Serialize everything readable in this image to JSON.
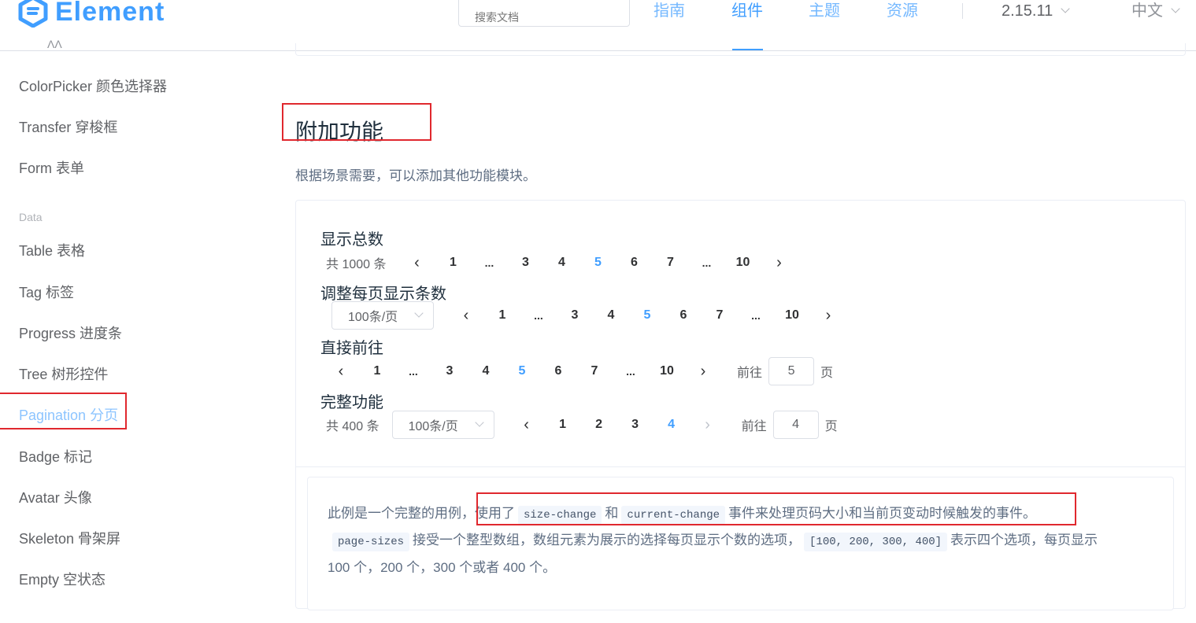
{
  "header": {
    "logo_text": "Element",
    "search_placeholder": "搜索文档",
    "nav": [
      "指南",
      "组件",
      "主题",
      "资源"
    ],
    "active_nav": "组件",
    "version": "2.15.11",
    "language": "中文"
  },
  "sidebar": {
    "cut_item": "ΛΛ",
    "items": [
      "ColorPicker 颜色选择器",
      "Transfer 穿梭框",
      "Form 表单"
    ],
    "group": "Data",
    "data_items": [
      "Table 表格",
      "Tag 标签",
      "Progress 进度条",
      "Tree 树形控件",
      "Pagination 分页",
      "Badge 标记",
      "Avatar 头像",
      "Skeleton 骨架屏",
      "Empty 空状态"
    ],
    "active_item": "Pagination 分页"
  },
  "main": {
    "section_title": "附加功能",
    "description": "根据场景需要，可以添加其他功能模块。",
    "demos": {
      "total": {
        "title": "显示总数",
        "total_label": "共 1000 条",
        "pages": [
          "1",
          "...",
          "3",
          "4",
          "5",
          "6",
          "7",
          "...",
          "10"
        ],
        "current": "5"
      },
      "sizes": {
        "title": "调整每页显示条数",
        "size_value": "100条/页",
        "pages": [
          "1",
          "...",
          "3",
          "4",
          "5",
          "6",
          "7",
          "...",
          "10"
        ],
        "current": "5"
      },
      "jumper": {
        "title": "直接前往",
        "pages": [
          "1",
          "...",
          "3",
          "4",
          "5",
          "6",
          "7",
          "...",
          "10"
        ],
        "current": "5",
        "goto_label": "前往",
        "goto_value": "5",
        "page_suffix": "页"
      },
      "full": {
        "title": "完整功能",
        "total_label": "共 400 条",
        "size_value": "100条/页",
        "pages": [
          "1",
          "2",
          "3",
          "4"
        ],
        "current": "4",
        "goto_label": "前往",
        "goto_value": "4",
        "page_suffix": "页"
      }
    },
    "explain": {
      "line1_a": "此例是一个完整的用例，",
      "line1_b": "使用了",
      "code1": "size-change",
      "line1_c": "和",
      "code2": "current-change",
      "line1_d": "事件来处理页码大小和当前页变动时候触发的事件。",
      "code3": "page-sizes",
      "line2_a": "接受一个整型数组，数组元素为展示的选择每页显示个数的选项，",
      "code4": "[100, 200, 300, 400]",
      "line2_b": "表示四个选项，每页显示",
      "line3": "100 个，200 个，300 个或者 400 个。"
    }
  },
  "colors": {
    "primary": "#409eff",
    "highlight_border": "#e0282e"
  }
}
